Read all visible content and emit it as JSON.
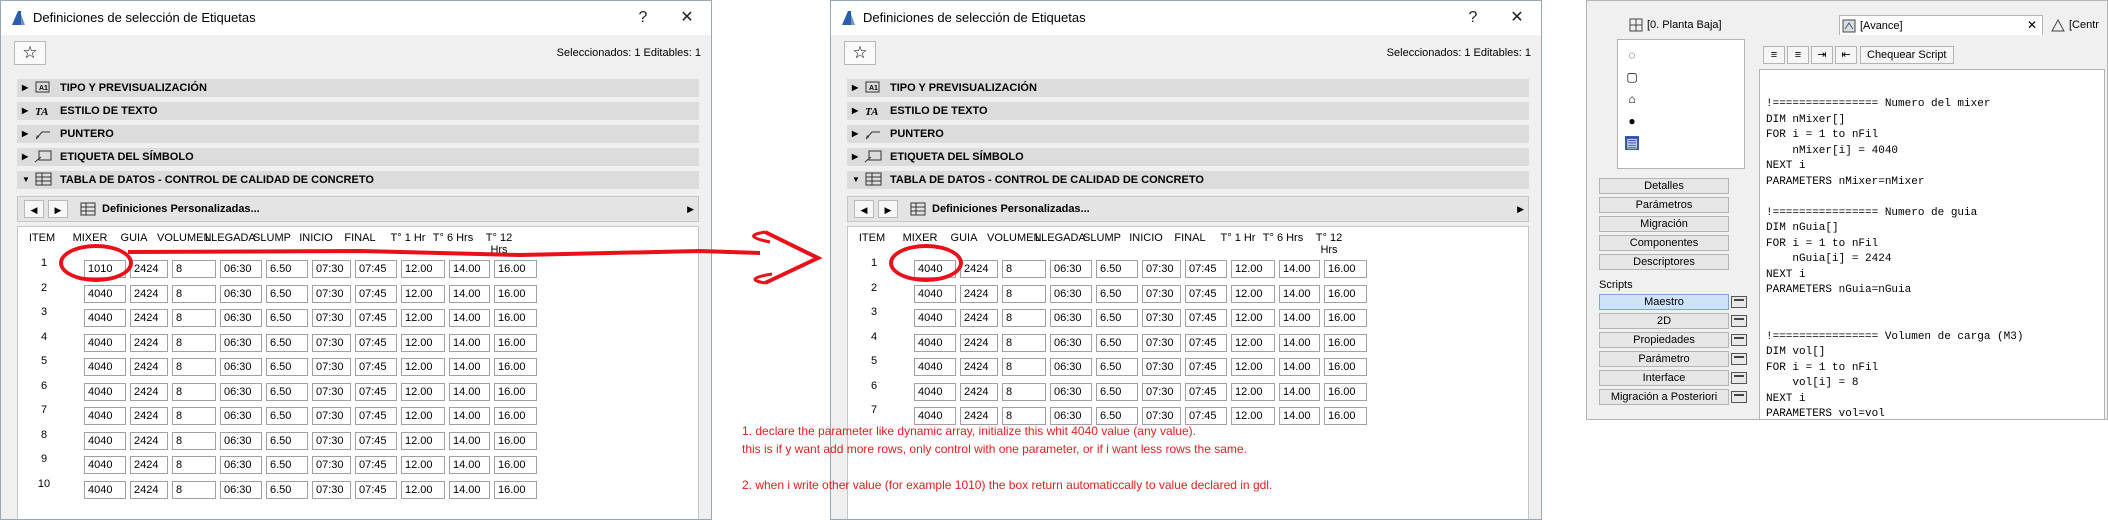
{
  "dialog": {
    "title": "Definiciones de selección de Etiquetas",
    "help_label": "?",
    "close_label": "✕",
    "favorites_label": "☆",
    "selection_info": "Seleccionados: 1 Editables: 1",
    "sections": [
      {
        "label": "TIPO Y PREVISUALIZACIÓN",
        "icon": "preview-icon"
      },
      {
        "label": "ESTILO DE TEXTO",
        "icon": "text-style-icon"
      },
      {
        "label": "PUNTERO",
        "icon": "pointer-icon"
      },
      {
        "label": "ETIQUETA DEL SÍMBOLO",
        "icon": "symbol-label-icon"
      },
      {
        "label": "TABLA DE DATOS - CONTROL DE CALIDAD DE CONCRETO",
        "icon": "data-table-icon"
      }
    ],
    "toolbar": {
      "custom_label": "Definiciones Personalizadas...",
      "prev_label": "◀",
      "next_label": "▶",
      "scroll_label": "▶"
    },
    "columns": [
      "ITEM",
      "MIXER",
      "GUIA",
      "VOLUMEN",
      "LLEGADA",
      "SLUMP",
      "INICIO",
      "FINAL",
      "T° 1 Hr",
      "T° 6 Hrs",
      "T° 12 Hrs"
    ]
  },
  "left_table": {
    "rows": [
      {
        "item": "1",
        "values": [
          "1010",
          "2424",
          "8",
          "06:30",
          "6.50",
          "07:30",
          "07:45",
          "12.00",
          "14.00",
          "16.00"
        ]
      },
      {
        "item": "2",
        "values": [
          "4040",
          "2424",
          "8",
          "06:30",
          "6.50",
          "07:30",
          "07:45",
          "12.00",
          "14.00",
          "16.00"
        ]
      },
      {
        "item": "3",
        "values": [
          "4040",
          "2424",
          "8",
          "06:30",
          "6.50",
          "07:30",
          "07:45",
          "12.00",
          "14.00",
          "16.00"
        ]
      },
      {
        "item": "4",
        "values": [
          "4040",
          "2424",
          "8",
          "06:30",
          "6.50",
          "07:30",
          "07:45",
          "12.00",
          "14.00",
          "16.00"
        ]
      },
      {
        "item": "5",
        "values": [
          "4040",
          "2424",
          "8",
          "06:30",
          "6.50",
          "07:30",
          "07:45",
          "12.00",
          "14.00",
          "16.00"
        ]
      },
      {
        "item": "6",
        "values": [
          "4040",
          "2424",
          "8",
          "06:30",
          "6.50",
          "07:30",
          "07:45",
          "12.00",
          "14.00",
          "16.00"
        ]
      },
      {
        "item": "7",
        "values": [
          "4040",
          "2424",
          "8",
          "06:30",
          "6.50",
          "07:30",
          "07:45",
          "12.00",
          "14.00",
          "16.00"
        ]
      },
      {
        "item": "8",
        "values": [
          "4040",
          "2424",
          "8",
          "06:30",
          "6.50",
          "07:30",
          "07:45",
          "12.00",
          "14.00",
          "16.00"
        ]
      },
      {
        "item": "9",
        "values": [
          "4040",
          "2424",
          "8",
          "06:30",
          "6.50",
          "07:30",
          "07:45",
          "12.00",
          "14.00",
          "16.00"
        ]
      },
      {
        "item": "10",
        "values": [
          "4040",
          "2424",
          "8",
          "06:30",
          "6.50",
          "07:30",
          "07:45",
          "12.00",
          "14.00",
          "16.00"
        ]
      }
    ]
  },
  "right_table": {
    "rows": [
      {
        "item": "1",
        "values": [
          "4040",
          "2424",
          "8",
          "06:30",
          "6.50",
          "07:30",
          "07:45",
          "12.00",
          "14.00",
          "16.00"
        ]
      },
      {
        "item": "2",
        "values": [
          "4040",
          "2424",
          "8",
          "06:30",
          "6.50",
          "07:30",
          "07:45",
          "12.00",
          "14.00",
          "16.00"
        ]
      },
      {
        "item": "3",
        "values": [
          "4040",
          "2424",
          "8",
          "06:30",
          "6.50",
          "07:30",
          "07:45",
          "12.00",
          "14.00",
          "16.00"
        ]
      },
      {
        "item": "4",
        "values": [
          "4040",
          "2424",
          "8",
          "06:30",
          "6.50",
          "07:30",
          "07:45",
          "12.00",
          "14.00",
          "16.00"
        ]
      },
      {
        "item": "5",
        "values": [
          "4040",
          "2424",
          "8",
          "06:30",
          "6.50",
          "07:30",
          "07:45",
          "12.00",
          "14.00",
          "16.00"
        ]
      },
      {
        "item": "6",
        "values": [
          "4040",
          "2424",
          "8",
          "06:30",
          "6.50",
          "07:30",
          "07:45",
          "12.00",
          "14.00",
          "16.00"
        ]
      },
      {
        "item": "7",
        "values": [
          "4040",
          "2424",
          "8",
          "06:30",
          "6.50",
          "07:30",
          "07:45",
          "12.00",
          "14.00",
          "16.00"
        ]
      }
    ]
  },
  "annotation": {
    "color": "#e8111a",
    "note_lines": [
      "1. declare the parameter like dynamic array, initialize this whit 4040 value (any value).",
      "this is if y want add more rows, only control with one parameter, or if i want less rows the same.",
      "",
      "2. when i write other value (for example 1010) the box return automaticcally to value declared in gdl."
    ]
  },
  "gdl_editor": {
    "tabs": [
      "[0. Planta Baja]",
      "[Avance]",
      "[Centr"
    ],
    "tab_close": "✕",
    "list_icons": [
      "◌",
      "▢",
      "⌂",
      "●",
      "▤"
    ],
    "buttons": [
      "Detalles",
      "Parámetros",
      "Migración",
      "Componentes",
      "Descriptores"
    ],
    "scripts_label": "Scripts",
    "scripts": [
      "Maestro",
      "2D",
      "Propiedades",
      "Parámetro",
      "Interface",
      "Migración a Posteriori"
    ],
    "selected_script": "Maestro",
    "format_buttons": [
      "≡",
      "≡",
      "⇥",
      "⇤"
    ],
    "check_script_label": "Chequear Script",
    "code_lines": [
      "!================ Numero del mixer",
      "DIM nMixer[]",
      "FOR i = 1 to nFil",
      "    nMixer[i] = 4040",
      "NEXT i",
      "PARAMETERS nMixer=nMixer",
      "",
      "!================ Numero de guia",
      "DIM nGuia[]",
      "FOR i = 1 to nFil",
      "    nGuia[i] = 2424",
      "NEXT i",
      "PARAMETERS nGuia=nGuia",
      "",
      "",
      "!================ Volumen de carga (M3)",
      "DIM vol[]",
      "FOR i = 1 to nFil",
      "    vol[i] = 8",
      "NEXT i",
      "PARAMETERS vol=vol"
    ]
  }
}
